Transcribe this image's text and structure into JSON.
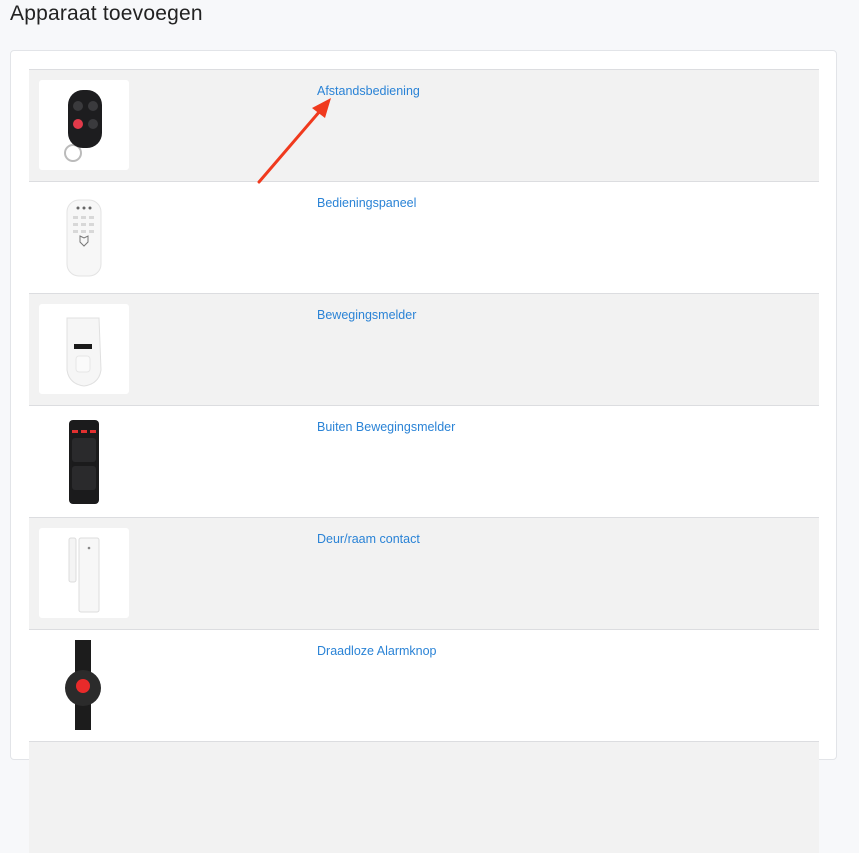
{
  "page": {
    "title": "Apparaat toevoegen"
  },
  "devices": [
    {
      "label": "Afstandsbediening",
      "icon": "remote-keyfob-icon"
    },
    {
      "label": "Bedieningspaneel",
      "icon": "keypad-icon"
    },
    {
      "label": "Bewegingsmelder",
      "icon": "motion-sensor-icon"
    },
    {
      "label": "Buiten Bewegingsmelder",
      "icon": "outdoor-motion-sensor-icon"
    },
    {
      "label": "Deur/raam contact",
      "icon": "door-window-contact-icon"
    },
    {
      "label": "Draadloze Alarmknop",
      "icon": "panic-button-icon"
    }
  ],
  "colors": {
    "link": "#2a83d6",
    "annotation_arrow": "#f03a1e",
    "row_shade": "#f2f2f2"
  }
}
